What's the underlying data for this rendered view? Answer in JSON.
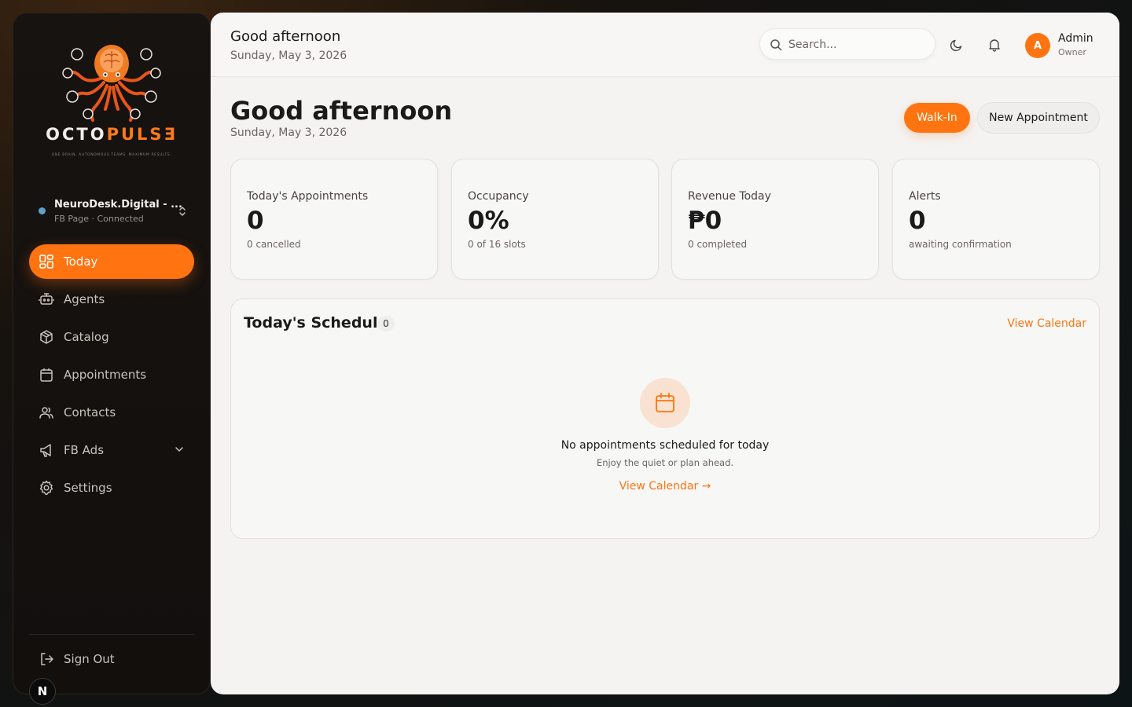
{
  "brand": {
    "name_part1": "OCTO",
    "name_part2": "PULSƎ",
    "tagline": "ONE BRAIN. AUTONOMOUS TEAMS. MAXIMUM RESULTS.",
    "accent_color": "#ff7410"
  },
  "workspace": {
    "name": "NeuroDesk.Digital - ...",
    "subtitle": "FB Page · Connected",
    "status_color": "#5fa0c6"
  },
  "sidebar": {
    "items": [
      {
        "label": "Today",
        "icon": "dashboard-grid-icon",
        "active": true
      },
      {
        "label": "Agents",
        "icon": "robot-icon"
      },
      {
        "label": "Catalog",
        "icon": "box-icon"
      },
      {
        "label": "Appointments",
        "icon": "calendar-icon"
      },
      {
        "label": "Contacts",
        "icon": "users-icon"
      },
      {
        "label": "FB Ads",
        "icon": "megaphone-icon"
      },
      {
        "label": "Settings",
        "icon": "gear-icon"
      }
    ],
    "signout": "Sign Out",
    "badge": "N"
  },
  "topbar": {
    "greeting": "Good afternoon",
    "date": "Sunday, May 3, 2026",
    "search_placeholder": "Search...",
    "user": {
      "initial": "A",
      "name": "Admin",
      "role": "Owner"
    }
  },
  "page": {
    "title": "Good afternoon",
    "date": "Sunday, May 3, 2026",
    "walkin_label": "Walk-In",
    "new_appointment_label": "New Appointment"
  },
  "stats": [
    {
      "label": "Today's Appointments",
      "value": "0",
      "sub": "0 cancelled"
    },
    {
      "label": "Occupancy",
      "value": "0%",
      "sub": "0 of 16 slots"
    },
    {
      "label": "Revenue Today",
      "value": "₱0",
      "sub": "0 completed"
    },
    {
      "label": "Alerts",
      "value": "0",
      "sub": "awaiting confirmation"
    }
  ],
  "schedule": {
    "title": "Today's Schedule",
    "count": "0",
    "view_calendar": "View Calendar",
    "empty_title": "No appointments scheduled for today",
    "empty_sub": "Enjoy the quiet or plan ahead.",
    "empty_link": "View Calendar →"
  }
}
